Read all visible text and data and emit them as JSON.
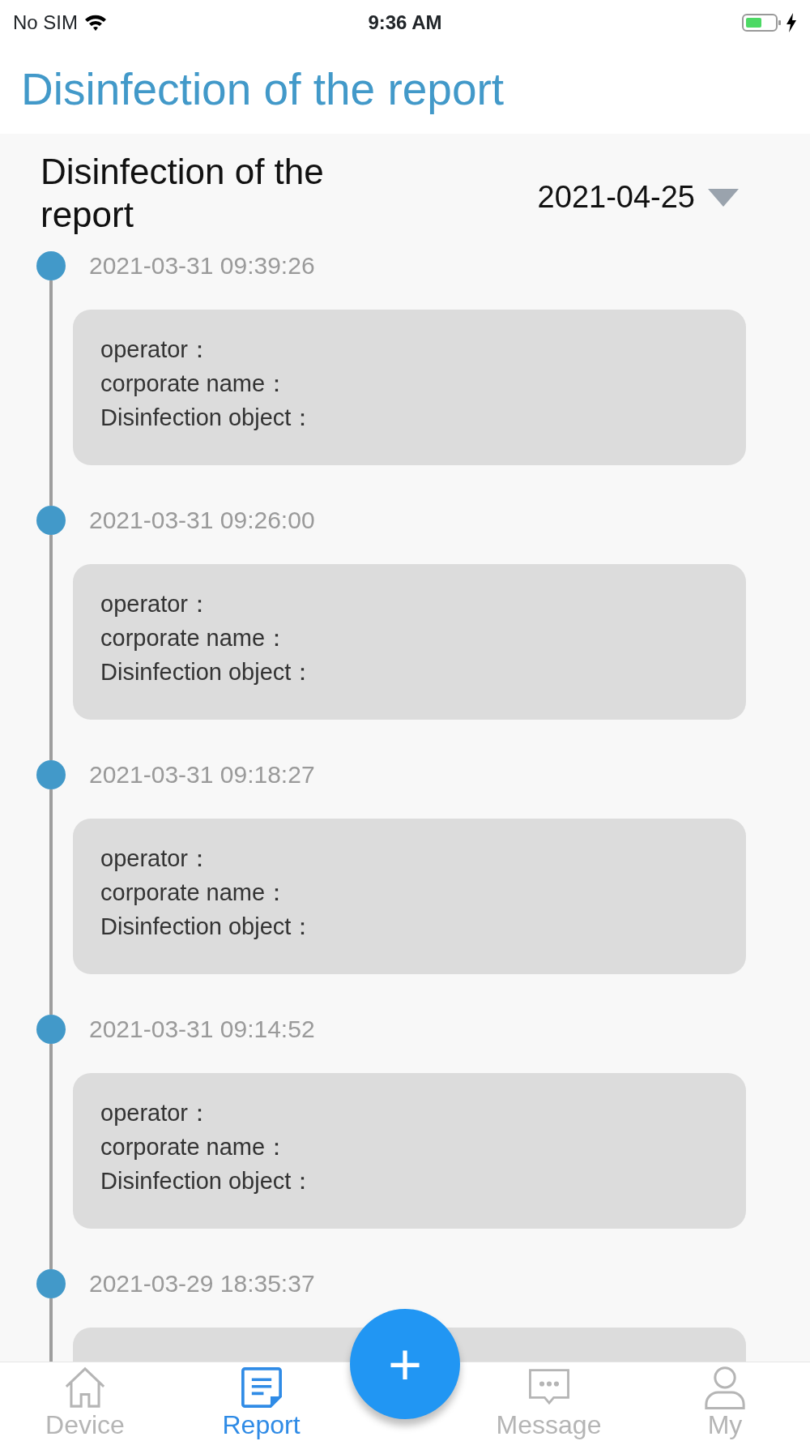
{
  "status_bar": {
    "carrier": "No SIM",
    "time": "9:36 AM"
  },
  "header": {
    "title": "Disinfection of the report"
  },
  "section": {
    "title": "Disinfection of the report",
    "date": "2021-04-25"
  },
  "records": [
    {
      "time": "2021-03-31 09:39:26",
      "lines": [
        "operator：",
        "corporate name：",
        "Disinfection object："
      ]
    },
    {
      "time": "2021-03-31 09:26:00",
      "lines": [
        "operator：",
        "corporate name：",
        "Disinfection object："
      ]
    },
    {
      "time": "2021-03-31 09:18:27",
      "lines": [
        "operator：",
        "corporate name：",
        "Disinfection object："
      ]
    },
    {
      "time": "2021-03-31 09:14:52",
      "lines": [
        "operator：",
        "corporate name：",
        "Disinfection object："
      ]
    },
    {
      "time": "2021-03-29 18:35:37"
    }
  ],
  "fab": {
    "label": "+"
  },
  "tabs": [
    {
      "label": "Device",
      "selected": false
    },
    {
      "label": "Report",
      "selected": true
    },
    {
      "label": "Message",
      "selected": false
    },
    {
      "label": "My",
      "selected": false
    }
  ]
}
